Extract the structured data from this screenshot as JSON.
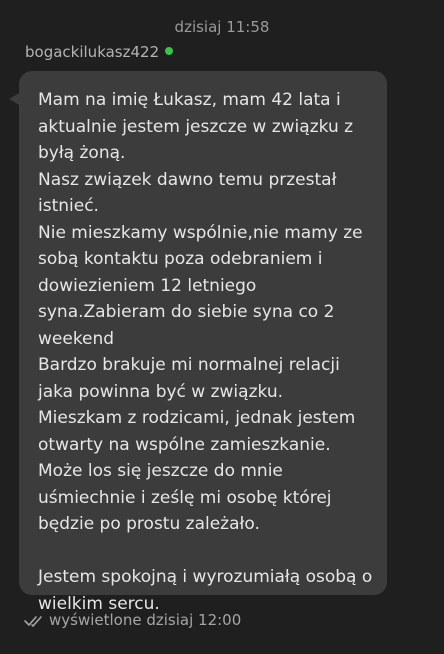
{
  "chat": {
    "timestamp": "dzisiaj 11:58",
    "sender": {
      "name": "bogackilukasz422",
      "online": true
    },
    "message": {
      "text": "Mam na imię Łukasz, mam 42 lata i aktualnie jestem jeszcze w związku z byłą żoną.\nNasz związek dawno temu przestał istnieć.\nNie mieszkamy wspólnie,nie mamy ze sobą kontaktu poza odebraniem i dowiezieniem 12 letniego syna.Zabieram do siebie syna co 2 weekend\nBardzo brakuje mi normalnej relacji jaka powinna być w związku.\nMieszkam z rodzicami, jednak jestem otwarty na wspólne zamieszkanie.\nMoże los się jeszcze do mnie uśmiechnie i ześlę mi osobę której będzie po prostu zależało.\n\nJestem spokojną i wyrozumiałą osobą o wielkim sercu."
    },
    "status": {
      "icon": "double-check-icon",
      "text": "wyświetlone dzisiaj 12:00"
    }
  },
  "colors": {
    "background": "#1f1f1f",
    "bubble": "#3c3c3c",
    "online": "#37c44a",
    "message_text": "#e6e6e6",
    "meta_text": "#9a9a9a"
  }
}
